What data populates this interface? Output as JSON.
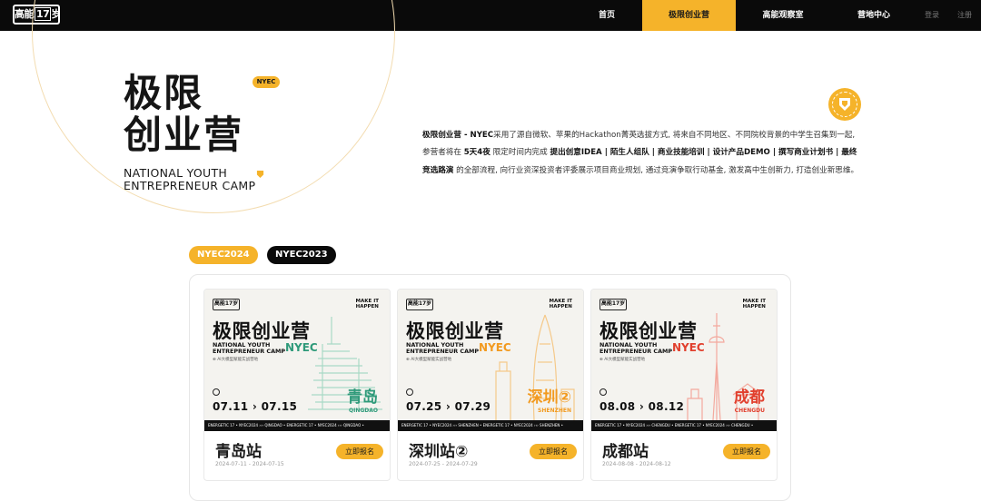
{
  "nav": {
    "logo_text": "高能",
    "logo_num": "17",
    "logo_suffix": "岁",
    "items": [
      {
        "label": "首页"
      },
      {
        "label": "极限创业营"
      },
      {
        "label": "高能观察室"
      },
      {
        "label": "营地中心"
      }
    ],
    "login": "登录",
    "register": "注册"
  },
  "hero": {
    "title_line1": "极限",
    "title_line2": "创业营",
    "tag": "NYEC",
    "en_line1": "NATIONAL YOUTH",
    "en_line2": "ENTREPRENEUR CAMP",
    "intro": {
      "p1_bold": "极限创业营 - NYEC",
      "p1": "采用了源自微软、苹果的Hackathon菁英选拔方式, 将来自不同地区、不同院校背景的中学生召集到一起, 参营者将在 ",
      "p2_bold": "5天4夜",
      "p2": " 限定时间内完成 ",
      "p3_bold": "提出创意IDEA | 陌生人组队 | 商业技能培训 | 设计产品DEMO | 撰写商业计划书 | 最终竞选路演",
      "p3": " 的全部流程, 向行业资深投资者评委展示项目商业规划, 通过竞演争取行动基金, 激发高中生创新力, 打造创业新思维。"
    }
  },
  "tabs": [
    {
      "label": "NYEC2024"
    },
    {
      "label": "NYEC2023"
    }
  ],
  "colors": {
    "accent": "#f5b32a",
    "dark": "#0a0a0a",
    "teal": "#2f9a7a",
    "orange": "#f29a1f",
    "red": "#e1402e"
  },
  "cards": [
    {
      "name": "青岛站",
      "date": "2024-07-11 - 2024-07-15",
      "button": "立即报名",
      "poster": {
        "logo": "高能17岁",
        "make": "MAKE IT",
        "happen": "HAPPEN",
        "title": "极限创业营",
        "en1": "NATIONAL YOUTH",
        "en2": "ENTREPRENEUR CAMP",
        "nyec": "NYEC",
        "ai": "⊕ AI大模型赋能实战营地",
        "dates": "07.11 › 07.15",
        "city": "青岛",
        "city_en": "QINGDAO",
        "strip": "ENERGETIC 17 • NYEC2024 ››› QINGDAO • ENERGETIC 17 • NYEC2024 ››› QINGDAO •",
        "color": "#2f9a7a"
      }
    },
    {
      "name": "深圳站②",
      "date": "2024-07-25 - 2024-07-29",
      "button": "立即报名",
      "poster": {
        "logo": "高能17岁",
        "make": "MAKE IT",
        "happen": "HAPPEN",
        "title": "极限创业营",
        "en1": "NATIONAL YOUTH",
        "en2": "ENTREPRENEUR CAMP",
        "nyec": "NYEC",
        "ai": "⊕ AI大模型赋能实战营地",
        "dates": "07.25 › 07.29",
        "city": "深圳②",
        "city_en": "SHENZHEN",
        "strip": "ENERGETIC 17 • NYEC2024 ››› SHENZHEN • ENERGETIC 17 • NYEC2024 ››› SHENZHEN •",
        "color": "#f29a1f"
      }
    },
    {
      "name": "成都站",
      "date": "2024-08-08 - 2024-08-12",
      "button": "立即报名",
      "poster": {
        "logo": "高能17岁",
        "make": "MAKE IT",
        "happen": "HAPPEN",
        "title": "极限创业营",
        "en1": "NATIONAL YOUTH",
        "en2": "ENTREPRENEUR CAMP",
        "nyec": "NYEC",
        "ai": "⊕ AI大模型赋能实战营地",
        "dates": "08.08 › 08.12",
        "city": "成都",
        "city_en": "CHENGDU",
        "strip": "ENERGETIC 17 • NYEC2024 ››› CHENGDU • ENERGETIC 17 • NYEC2024 ››› CHENGDU •",
        "color": "#e1402e"
      }
    }
  ]
}
